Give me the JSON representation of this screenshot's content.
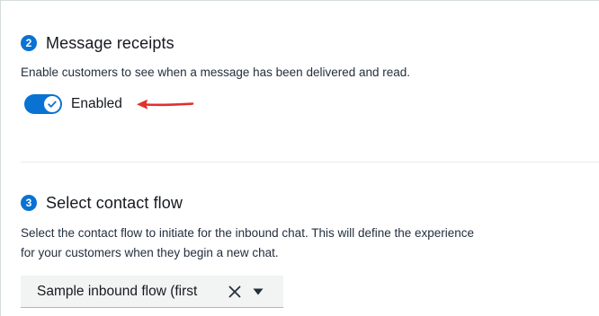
{
  "message_receipts": {
    "step_number": "2",
    "title": "Message receipts",
    "description": "Enable customers to see when a message has been delivered and read.",
    "toggle": {
      "label": "Enabled",
      "state": "on",
      "color": "#0972d3"
    },
    "annotation_arrow_color": "#e0312f"
  },
  "contact_flow": {
    "step_number": "3",
    "title": "Select contact flow",
    "description_line1": "Select the contact flow to initiate for the inbound chat. This will define the experience",
    "description_line2": "for your customers when they begin a new chat.",
    "select": {
      "value": "Sample inbound flow (first"
    }
  },
  "icons": {
    "toggle_check": "check-icon",
    "clear": "close-icon",
    "dropdown": "caret-down-icon"
  }
}
